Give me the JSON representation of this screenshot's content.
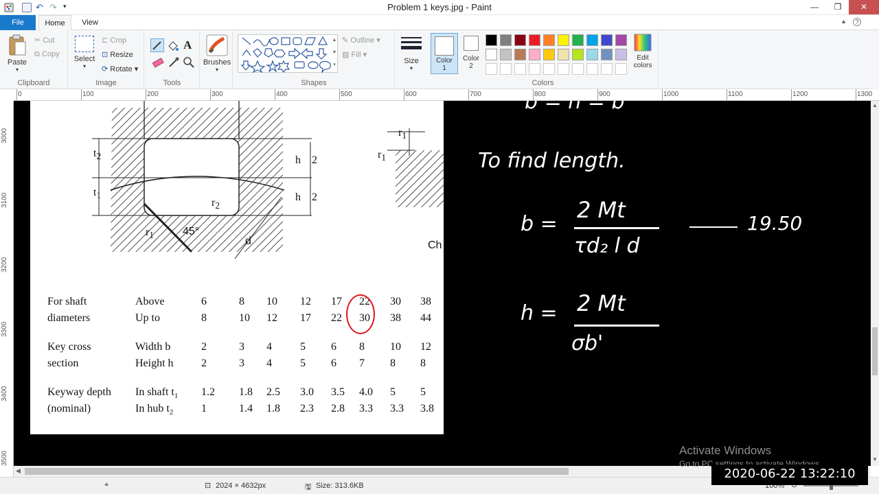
{
  "window": {
    "title": "Problem 1 keys.jpg - Paint"
  },
  "tabs": [
    {
      "label": "File"
    },
    {
      "label": "Home"
    },
    {
      "label": "View"
    }
  ],
  "clipboard": {
    "paste": "Paste",
    "cut": "Cut",
    "copy": "Copy",
    "group": "Clipboard"
  },
  "image_group": {
    "select": "Select",
    "crop": "Crop",
    "resize": "Resize",
    "rotate": "Rotate",
    "group": "Image"
  },
  "tools_group": {
    "group": "Tools",
    "text_tool": "A"
  },
  "brushes": {
    "label": "Brushes"
  },
  "shapes_group": {
    "outline": "Outline",
    "fill": "Fill",
    "group": "Shapes"
  },
  "size": {
    "label": "Size"
  },
  "colors_group": {
    "color1": "Color 1",
    "color2": "Color 2",
    "edit": "Edit colors",
    "group": "Colors",
    "row1": [
      "#000000",
      "#7f7f7f",
      "#880015",
      "#ed1c24",
      "#ff7f27",
      "#fff200",
      "#22b14c",
      "#00a2e8",
      "#3f48cc",
      "#a349a4"
    ],
    "row2": [
      "#ffffff",
      "#c3c3c3",
      "#b97a57",
      "#ffaec9",
      "#ffc90e",
      "#efe4b0",
      "#b5e61d",
      "#99d9ea",
      "#7092be",
      "#c8bfe7"
    ]
  },
  "ruler": {
    "h": [
      "0",
      "100",
      "200",
      "300",
      "400",
      "500",
      "600",
      "700",
      "800",
      "900",
      "1000",
      "1100",
      "1200",
      "1300"
    ],
    "v": [
      "3000",
      "3100",
      "3200",
      "3300",
      "3400",
      "3500"
    ]
  },
  "figure": {
    "h": "h",
    "two": "2",
    "t1": "t",
    "sub1": "1",
    "t2": "t",
    "sub2": "2",
    "r1": "r",
    "r2": "r",
    "deg": "45°",
    "d": "d",
    "ch": "Ch"
  },
  "table": {
    "rows": [
      {
        "label": "For shaft",
        "sub": "Above",
        "vals": [
          "6",
          "8",
          "10",
          "12",
          "17",
          "22",
          "30",
          "38"
        ]
      },
      {
        "label": "diameters",
        "sub": "Up to",
        "vals": [
          "8",
          "10",
          "12",
          "17",
          "22",
          "30",
          "38",
          "44"
        ]
      },
      {
        "label": "Key cross",
        "sub": "Width b",
        "vals": [
          "2",
          "3",
          "4",
          "5",
          "6",
          "8",
          "10",
          "12"
        ]
      },
      {
        "label": "section",
        "sub": "Height h",
        "vals": [
          "2",
          "3",
          "4",
          "5",
          "6",
          "7",
          "8",
          "8"
        ]
      },
      {
        "label": "Keyway depth",
        "sub": "In shaft t",
        "subscript": "1",
        "vals": [
          "1.2",
          "1.8",
          "2.5",
          "3.0",
          "3.5",
          "4.0",
          "5",
          "5"
        ]
      },
      {
        "label": "(nominal)",
        "sub": "In hub t",
        "subscript": "2",
        "vals": [
          "1",
          "1.4",
          "1.8",
          "2.3",
          "2.8",
          "3.3",
          "3.3",
          "3.8"
        ]
      }
    ]
  },
  "notes": {
    "heading": "To find length.",
    "b_eq": "b =",
    "b_num": "2 Mt",
    "b_den": "τd₂ l d",
    "b_result": "19.50",
    "h_eq": "h =",
    "h_num": "2 Mt",
    "h_den": "σb'",
    "top_partial": "b = h = b"
  },
  "status": {
    "dimensions": "2024 × 4632px",
    "size": "Size: 313.6KB",
    "zoom": "100%"
  },
  "overlay": {
    "activate": "Activate Windows",
    "activate_sub": "Go to PC settings to activate Windows.",
    "timestamp": "2020-06-22  13:22:10"
  }
}
